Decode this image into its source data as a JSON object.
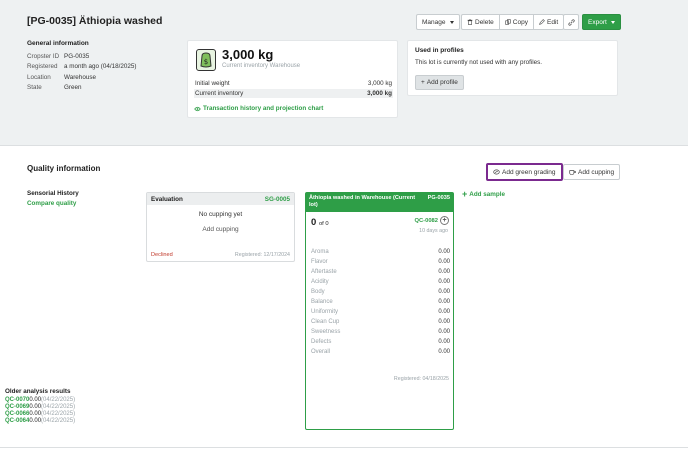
{
  "header": {
    "title": "[PG-0035] Äthiopia washed",
    "manage_label": "Manage",
    "delete_label": "Delete",
    "copy_label": "Copy",
    "edit_label": "Edit",
    "export_label": "Export"
  },
  "general": {
    "heading": "General information",
    "rows": [
      {
        "key": "Cropster ID",
        "value": "PG-0035"
      },
      {
        "key": "Registered",
        "value": "a month ago (04/18/2025)"
      },
      {
        "key": "Location",
        "value": "Warehouse"
      },
      {
        "key": "State",
        "value": "Green"
      }
    ]
  },
  "inventory": {
    "amount": "3,000 kg",
    "subtitle": "Current inventory Warehouse",
    "initial_label": "Initial weight",
    "initial_value": "3,000 kg",
    "current_label": "Current inventory",
    "current_value": "3,000 kg",
    "link": "Transaction history and projection chart"
  },
  "profiles": {
    "heading": "Used in profiles",
    "text": "This lot is currently not used with any profiles.",
    "add_label": "Add profile"
  },
  "quality": {
    "title": "Quality information",
    "add_green_grading": "Add green grading",
    "add_cupping": "Add cupping",
    "sensorial_history": "Sensorial History",
    "compare_quality": "Compare quality",
    "add_sample": "Add sample"
  },
  "evaluation": {
    "title": "Evaluation",
    "code": "SG-0005",
    "no_cupping": "No cupping yet",
    "add_cupping": "Add cupping",
    "status": "Declined",
    "registered": "Registered: 12/17/2024"
  },
  "green_card": {
    "title": "Äthiopia washed in Warehouse (Current lot)",
    "code": "PG-0035",
    "score": "0",
    "score_of": "of 0",
    "qc_code": "QC-0082",
    "ago": "10 days ago",
    "attributes": [
      {
        "name": "Aroma",
        "value": "0.00"
      },
      {
        "name": "Flavor",
        "value": "0.00"
      },
      {
        "name": "Aftertaste",
        "value": "0.00"
      },
      {
        "name": "Acidity",
        "value": "0.00"
      },
      {
        "name": "Body",
        "value": "0.00"
      },
      {
        "name": "Balance",
        "value": "0.00"
      },
      {
        "name": "Uniformity",
        "value": "0.00"
      },
      {
        "name": "Clean Cup",
        "value": "0.00"
      },
      {
        "name": "Sweetness",
        "value": "0.00"
      },
      {
        "name": "Defects",
        "value": "0.00"
      },
      {
        "name": "Overall",
        "value": "0.00"
      }
    ],
    "registered": "Registered: 04/18/2025",
    "older_heading": "Older analysis results",
    "older": [
      {
        "code": "QC-0070",
        "score": "0.00",
        "date": "(04/22/2025)"
      },
      {
        "code": "QC-0069",
        "score": "0.00",
        "date": "(04/22/2025)"
      },
      {
        "code": "QC-0066",
        "score": "0.00",
        "date": "(04/22/2025)"
      },
      {
        "code": "QC-0064",
        "score": "0.00",
        "date": "(04/22/2025)"
      }
    ]
  },
  "colors": {
    "accent": "#2e9e47",
    "highlight": "#7b2a8f",
    "declined": "#c0392b"
  }
}
